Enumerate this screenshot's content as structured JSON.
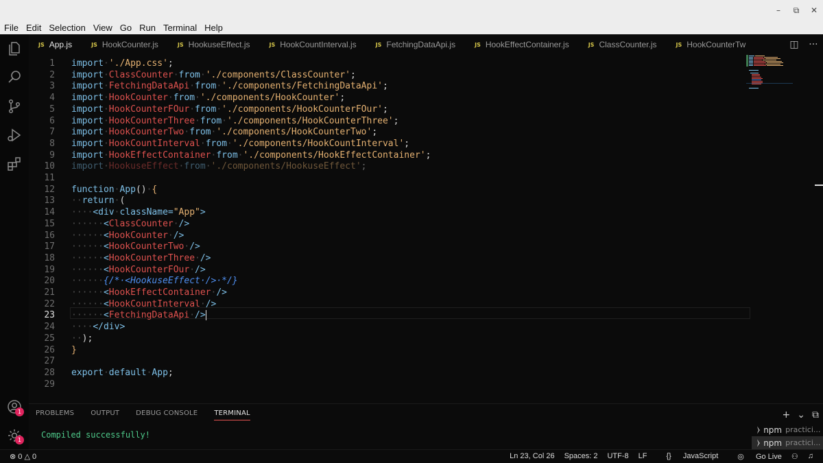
{
  "menu": [
    "File",
    "Edit",
    "Selection",
    "View",
    "Go",
    "Run",
    "Terminal",
    "Help"
  ],
  "window_controls": {
    "minimize": "–",
    "maximize": "⧉",
    "close": "✕"
  },
  "tabs": [
    {
      "label": "App.js",
      "active": true
    },
    {
      "label": "HookCounter.js",
      "active": false
    },
    {
      "label": "HookuseEffect.js",
      "active": false
    },
    {
      "label": "HookCountInterval.js",
      "active": false
    },
    {
      "label": "FetchingDataApi.js",
      "active": false
    },
    {
      "label": "HookEffectContainer.js",
      "active": false
    },
    {
      "label": "ClassCounter.js",
      "active": false
    },
    {
      "label": "HookCounterTw",
      "active": false
    }
  ],
  "tab_file_icon": "JS",
  "editor": {
    "current_line": 23,
    "lines": [
      [
        [
          "import",
          "kw"
        ],
        [
          "·",
          "ws"
        ],
        [
          "'./App.css'",
          "str"
        ],
        [
          ";",
          "plain"
        ]
      ],
      [
        [
          "import",
          "kw"
        ],
        [
          "·",
          "ws"
        ],
        [
          "ClassCounter",
          "comp"
        ],
        [
          "·",
          "ws"
        ],
        [
          "from",
          "kw"
        ],
        [
          "·",
          "ws"
        ],
        [
          "'./components/ClassCounter'",
          "str"
        ],
        [
          ";",
          "plain"
        ]
      ],
      [
        [
          "import",
          "kw"
        ],
        [
          "·",
          "ws"
        ],
        [
          "FetchingDataApi",
          "comp"
        ],
        [
          "·",
          "ws"
        ],
        [
          "from",
          "kw"
        ],
        [
          "·",
          "ws"
        ],
        [
          "'./components/FetchingDataApi'",
          "str"
        ],
        [
          ";",
          "plain"
        ]
      ],
      [
        [
          "import",
          "kw"
        ],
        [
          "·",
          "ws"
        ],
        [
          "HookCounter",
          "comp"
        ],
        [
          "·",
          "ws"
        ],
        [
          "from",
          "kw"
        ],
        [
          "·",
          "ws"
        ],
        [
          "'./components/HookCounter'",
          "str"
        ],
        [
          ";",
          "plain"
        ]
      ],
      [
        [
          "import",
          "kw"
        ],
        [
          "·",
          "ws"
        ],
        [
          "HookCounterFOur",
          "comp"
        ],
        [
          "·",
          "ws"
        ],
        [
          "from",
          "kw"
        ],
        [
          "·",
          "ws"
        ],
        [
          "'./components/HookCounterFOur'",
          "str"
        ],
        [
          ";",
          "plain"
        ]
      ],
      [
        [
          "import",
          "kw"
        ],
        [
          "·",
          "ws"
        ],
        [
          "HookCounterThree",
          "comp"
        ],
        [
          "·",
          "ws"
        ],
        [
          "from",
          "kw"
        ],
        [
          "·",
          "ws"
        ],
        [
          "'./components/HookCounterThree'",
          "str"
        ],
        [
          ";",
          "plain"
        ]
      ],
      [
        [
          "import",
          "kw"
        ],
        [
          "·",
          "ws"
        ],
        [
          "HookCounterTwo",
          "comp"
        ],
        [
          "·",
          "ws"
        ],
        [
          "from",
          "kw"
        ],
        [
          "·",
          "ws"
        ],
        [
          "'./components/HookCounterTwo'",
          "str"
        ],
        [
          ";",
          "plain"
        ]
      ],
      [
        [
          "import",
          "kw"
        ],
        [
          "·",
          "ws"
        ],
        [
          "HookCountInterval",
          "comp"
        ],
        [
          "·",
          "ws"
        ],
        [
          "from",
          "kw"
        ],
        [
          "·",
          "ws"
        ],
        [
          "'./components/HookCountInterval'",
          "str"
        ],
        [
          ";",
          "plain"
        ]
      ],
      [
        [
          "import",
          "kw"
        ],
        [
          "·",
          "ws"
        ],
        [
          "HookEffectContainer",
          "comp"
        ],
        [
          "·",
          "ws"
        ],
        [
          "from",
          "kw"
        ],
        [
          "·",
          "ws"
        ],
        [
          "'./components/HookEffectContainer'",
          "str"
        ],
        [
          ";",
          "plain"
        ]
      ],
      [
        [
          "import",
          "kw faded"
        ],
        [
          "·",
          "ws"
        ],
        [
          "HookuseEffect",
          "comp faded"
        ],
        [
          "·",
          "ws"
        ],
        [
          "from",
          "kw faded"
        ],
        [
          "·",
          "ws"
        ],
        [
          "'./components/HookuseEffect'",
          "str faded"
        ],
        [
          ";",
          "plain faded"
        ]
      ],
      [],
      [
        [
          "function",
          "kw"
        ],
        [
          "·",
          "ws"
        ],
        [
          "App",
          "kw"
        ],
        [
          "()",
          "plain"
        ],
        [
          "·",
          "ws"
        ],
        [
          "{",
          "str"
        ]
      ],
      [
        [
          "··",
          "ws"
        ],
        [
          "return",
          "kw"
        ],
        [
          "·",
          "ws"
        ],
        [
          "(",
          "plain"
        ]
      ],
      [
        [
          "····",
          "ws"
        ],
        [
          "<div",
          "kw"
        ],
        [
          "·",
          "ws"
        ],
        [
          "className=",
          "kw"
        ],
        [
          "\"App\"",
          "str"
        ],
        [
          ">",
          "kw"
        ]
      ],
      [
        [
          "······",
          "ws"
        ],
        [
          "<",
          "kw"
        ],
        [
          "ClassCounter",
          "comp"
        ],
        [
          "·",
          "ws"
        ],
        [
          "/>",
          "kw"
        ]
      ],
      [
        [
          "······",
          "ws"
        ],
        [
          "<",
          "kw"
        ],
        [
          "HookCounter",
          "comp"
        ],
        [
          "·",
          "ws"
        ],
        [
          "/>",
          "kw"
        ]
      ],
      [
        [
          "······",
          "ws"
        ],
        [
          "<",
          "kw"
        ],
        [
          "HookCounterTwo",
          "comp"
        ],
        [
          "·",
          "ws"
        ],
        [
          "/>",
          "kw"
        ]
      ],
      [
        [
          "······",
          "ws"
        ],
        [
          "<",
          "kw"
        ],
        [
          "HookCounterThree",
          "comp"
        ],
        [
          "·",
          "ws"
        ],
        [
          "/>",
          "kw"
        ]
      ],
      [
        [
          "······",
          "ws"
        ],
        [
          "<",
          "kw"
        ],
        [
          "HookCounterFOur",
          "comp"
        ],
        [
          "·",
          "ws"
        ],
        [
          "/>",
          "kw"
        ]
      ],
      [
        [
          "······",
          "ws"
        ],
        [
          "{/*·<HookuseEffect·/>·*/}",
          "cmt"
        ]
      ],
      [
        [
          "······",
          "ws"
        ],
        [
          "<",
          "kw"
        ],
        [
          "HookEffectContainer",
          "comp"
        ],
        [
          "·",
          "ws"
        ],
        [
          "/>",
          "kw"
        ]
      ],
      [
        [
          "······",
          "ws"
        ],
        [
          "<",
          "kw"
        ],
        [
          "HookCountInterval",
          "comp"
        ],
        [
          "·",
          "ws"
        ],
        [
          "/>",
          "kw"
        ]
      ],
      [
        [
          "······",
          "ws"
        ],
        [
          "<",
          "kw"
        ],
        [
          "FetchingDataApi",
          "comp"
        ],
        [
          "·",
          "ws"
        ],
        [
          "/>",
          "kw"
        ]
      ],
      [
        [
          "····",
          "ws"
        ],
        [
          "</div>",
          "kw"
        ]
      ],
      [
        [
          "··",
          "ws"
        ],
        [
          ")",
          "plain"
        ],
        [
          ";",
          "plain"
        ]
      ],
      [
        [
          "}",
          "str"
        ]
      ],
      [],
      [
        [
          "export",
          "kw"
        ],
        [
          "·",
          "ws"
        ],
        [
          "default",
          "kw"
        ],
        [
          "·",
          "ws"
        ],
        [
          "App",
          "kw"
        ],
        [
          ";",
          "plain"
        ]
      ],
      []
    ]
  },
  "panel": {
    "tabs": [
      "PROBLEMS",
      "OUTPUT",
      "DEBUG CONSOLE",
      "TERMINAL"
    ],
    "active_tab": "TERMINAL",
    "terminal_output": "Compiled successfully!",
    "actions": [
      "+",
      "⌄",
      "⧉"
    ],
    "terminals": [
      {
        "name": "npm",
        "sub": "practici..."
      },
      {
        "name": "npm",
        "sub": "practici..."
      }
    ]
  },
  "activity_badges": {
    "accounts": "1",
    "manage": "1"
  },
  "status": {
    "errors": "0",
    "warnings": "0",
    "position": "Ln 23, Col 26",
    "spaces": "Spaces: 2",
    "encoding": "UTF-8",
    "eol": "LF",
    "language": "JavaScript",
    "golive": "Go Live"
  },
  "colors": {
    "keyword": "#7ec0e8",
    "string": "#e6b272",
    "component": "#e0524f",
    "comment": "#4f8ff0",
    "terminal_text": "#4ec98a",
    "badge": "#e0245e"
  }
}
